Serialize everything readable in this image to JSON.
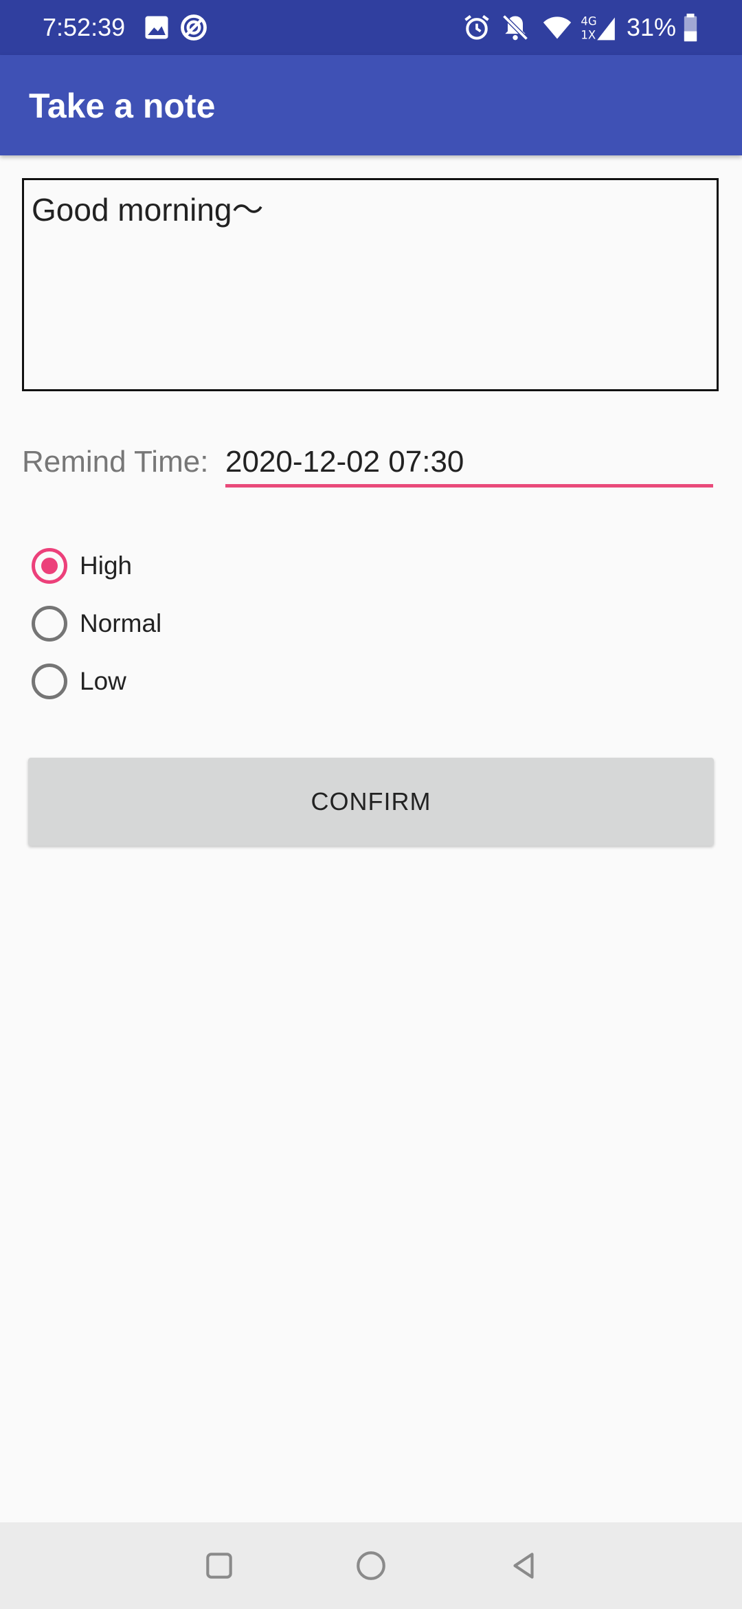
{
  "status_bar": {
    "time": "7:52:39",
    "battery": "31%",
    "icons": [
      "image-icon",
      "sync-icon",
      "alarm-icon",
      "bell-off-icon",
      "wifi-icon",
      "signal-4g-icon",
      "battery-icon"
    ]
  },
  "app_bar": {
    "title": "Take a note"
  },
  "note": {
    "content": "Good morning～"
  },
  "remind": {
    "label": "Remind Time:",
    "value": "2020-12-02 07:30"
  },
  "priority": {
    "options": [
      {
        "label": "High",
        "checked": true
      },
      {
        "label": "Normal",
        "checked": false
      },
      {
        "label": "Low",
        "checked": false
      }
    ]
  },
  "confirm_button": {
    "label": "CONFIRM"
  },
  "nav_bar": {
    "icons": [
      "recents-icon",
      "home-icon",
      "back-icon"
    ]
  },
  "colors": {
    "status_bar": "#303f9f",
    "app_bar": "#3f51b5",
    "accent": "#ec407a",
    "background": "#fafafa",
    "button": "#d6d7d7"
  }
}
